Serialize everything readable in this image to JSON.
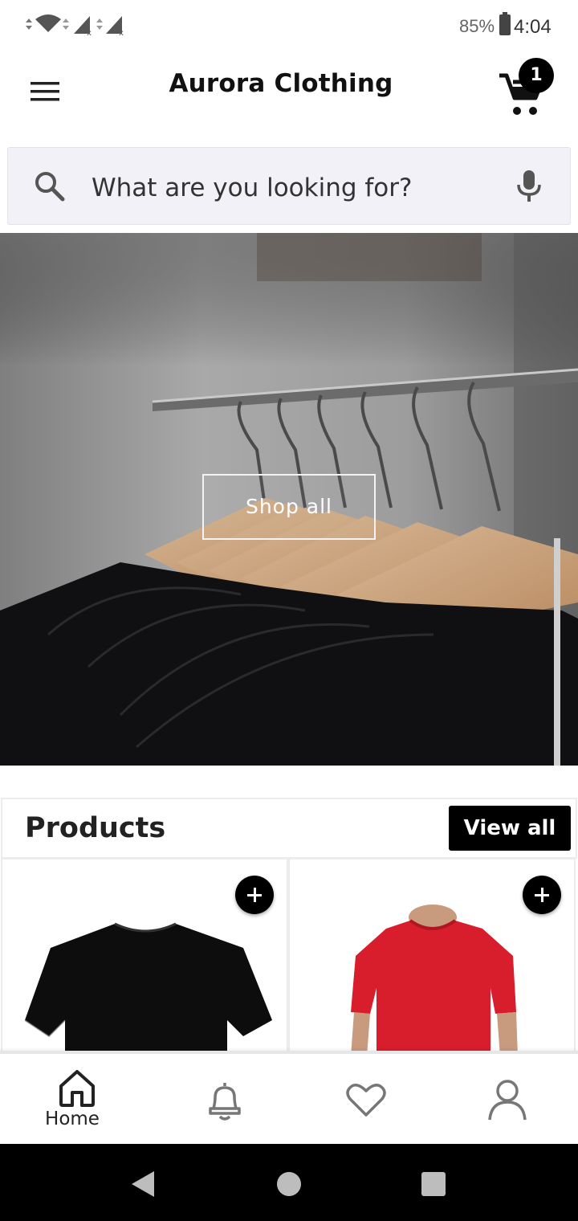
{
  "status_bar": {
    "battery": "85%",
    "time": "4:04"
  },
  "app": {
    "title": "Aurora Clothing",
    "cart_count": "1"
  },
  "search": {
    "placeholder": "What are you looking for?"
  },
  "hero": {
    "button_label": "Shop all"
  },
  "products": {
    "heading": "Products",
    "view_all_label": "View all",
    "items": [
      {
        "color": "#0e0e0e",
        "icon": "black-tshirt"
      },
      {
        "color": "#d81d2c",
        "icon": "red-tshirt-model"
      }
    ]
  },
  "bottom_nav": {
    "items": [
      {
        "label": "Home",
        "icon": "home-icon",
        "active": true
      },
      {
        "label": "",
        "icon": "bell-icon"
      },
      {
        "label": "",
        "icon": "heart-icon"
      },
      {
        "label": "",
        "icon": "user-icon"
      }
    ]
  },
  "colors": {
    "accent": "#000000",
    "search_bg": "#f1f1f7",
    "icon_gray": "#666666"
  }
}
